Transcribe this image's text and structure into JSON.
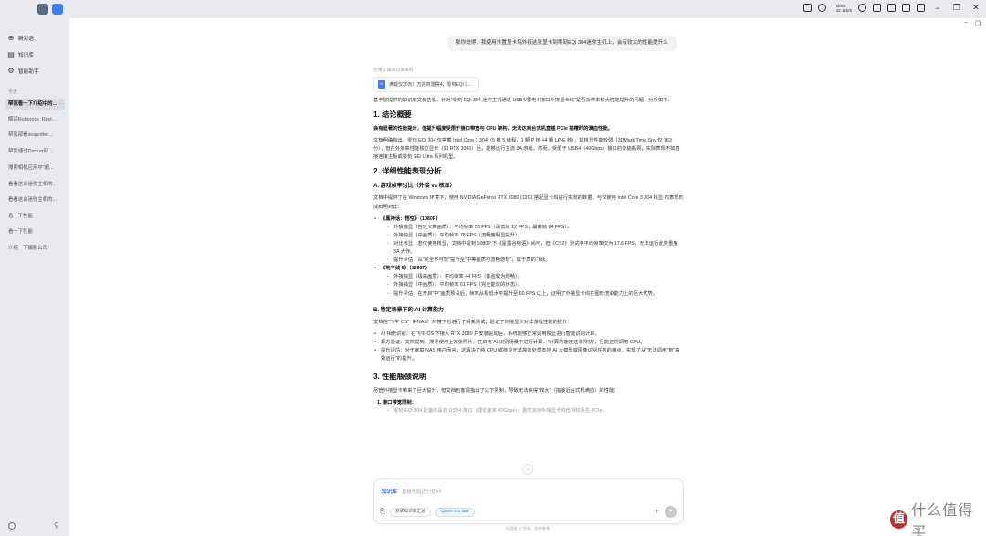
{
  "topbar": {
    "network_up": "↑ 1kb/s",
    "network_down": "↓ 42.1kb/s"
  },
  "sidebar": {
    "nav": [
      {
        "label": "新对话",
        "icon": "new-chat-icon"
      },
      {
        "label": "知识库",
        "icon": "book-icon"
      },
      {
        "label": "智能助手",
        "icon": "robot-icon"
      }
    ],
    "section_label": "今天",
    "conversations": [
      "帮我看一下介绍中的...",
      "解读Roborock_Revi...",
      "帮我部署snapotter...",
      "帮我通过Docker部...",
      "搜索相机应用中\"超...",
      "看看这台迷你主机的...",
      "看看这台迷你主机的...",
      "看一下性能",
      "看一下性能",
      "介绍一下摄影公司"
    ]
  },
  "chat": {
    "user_message": "那你觉得，我使用外置显卡坞外接这张显卡到零刻EQi 304迷你主机上，会有较大的性能提升么",
    "reference_label": "引用 1 篇知识库资料",
    "reference_title": "满载仅20瓦！万兆双雷雳4，零刻EQi 3...",
    "answer": {
      "intro": "基于您提供的知识库文档信息，针对\"零刻 EQi 304 迷你主机通过 USB4/雷电4 接口外接显卡坞\"是否会带来较大性能提升的问题，分析如下：",
      "h1": "1. 结论概要",
      "summary_bold": "会有显著的性能提升，但提升幅度受限于接口带宽与 CPU 架构，无法达到台式机直插 PCIe 插槽时的满血性能。",
      "summary_text": "文档明确指出，零刻 EQi 304 仅搭载 Intel Core 3 304（5 核 5 线程，1 颗 P 核 +4 颗 LP-E 核），其核显性能较弱（3DMark Time Spy 仅 763 分），但在外接高性能独立显卡（如 RTX 3080）后，能够运行主流 3A 游戏。然而，受限于 USB4（40Gbps）接口的传输瓶颈，实际表现不如直接连接主板或零刻 SEi Ultra 系列机型。",
      "h2": "2. 详细性能表现分析",
      "h2a": "A. 游戏帧率对比（外接 vs 核显）",
      "games_intro": "文档中提供了在 Windows 环境下，使用 NVIDIA GeForce RTX 3080 (12G) 搭配显卡坞进行实测的数据，与仅使用 Intel Core 3 304 核显 的表现形成鲜明对比：",
      "game1_title": "《黑神话：悟空》（1080P）",
      "game1_items": [
        "外接独显（自定义高画质）：平均帧率 53 FPS（最低帧 12 FPS，最高帧 64 FPS）。",
        "外接独显（中画质）：平均帧率 78 FPS（流畅度明显提升）。",
        "对比核显：若仅使用核显，文档中提到 1080P 下《星露谷物语》尚可，但《CS2》测试中平均帧率仅为 17.6 FPS，无法运行此类重度 3A 大作。",
        "提升评估：从\"完全不可玩\"提升至\"中等画质可流畅游玩\"，属于质的飞跃。"
      ],
      "game2_title": "《地平线 5》（1080P）",
      "game2_items": [
        "外接独显（极高画质）：平均帧率 44 FPS（体验较为顺畅）。",
        "外接独显（中画质）：平均帧率 61 FPS（完全能玩的状态）。",
        "提升评估：在开启\"中\"画质预设后，帧率从极低水平提升至 60 FPS 以上，证明了外接显卡坞在图形渲染能力上的巨大优势。"
      ],
      "h2b": "B. 特定场景下的 AI 计算能力",
      "ai_intro": "文档在\"飞牛 OS\"（FNAS）环境下也进行了相关测试，验证了外接显卡对非游戏性能的提升：",
      "ai_items": [
        "AI 相册识别：在飞牛 OS 下接入 RTX 3080 并安装驱动后，系统能够正常调用独显进行智能识别计算。",
        "算力验证：文档提到，搜寻使用上万张照片，在启用 AI 识别场景下进行计算，\"计算的速度还非常快\"，且能正常调用 GPU。",
        "提升评估：对于家庭 NAS 用户而言，这解决了纯 CPU 或核显无法高效处理本地 AI 大模型或图像识别任务的痛点，实现了从\"无法调用\"到\"高效运行\"的提升。"
      ],
      "h3": "3. 性能瓶颈说明",
      "bottleneck_intro": "尽管外接显卡带来了巨大提升，但文档也客观指出了以下限制，导致无法获得\"较大\"（指接近台式机满血）的性能：",
      "bottleneck_first": "1. 接口带宽限制：",
      "bottleneck_cut": "零刻 EQi 304 配备的是双 USB4 接口（理论速率 40Gbps），虽然支持外接显卡坞但相较原生 PCIe..."
    }
  },
  "input": {
    "kb_tag": "知识库",
    "placeholder": "直接开始进行提问",
    "chip_kb": "测试知识库汇总",
    "chip_model": "Qwen 3.5 35B",
    "disclaimer": "内容由 AI 生成，仅供参考"
  },
  "watermark": {
    "badge": "值",
    "text": "什么值得买"
  }
}
